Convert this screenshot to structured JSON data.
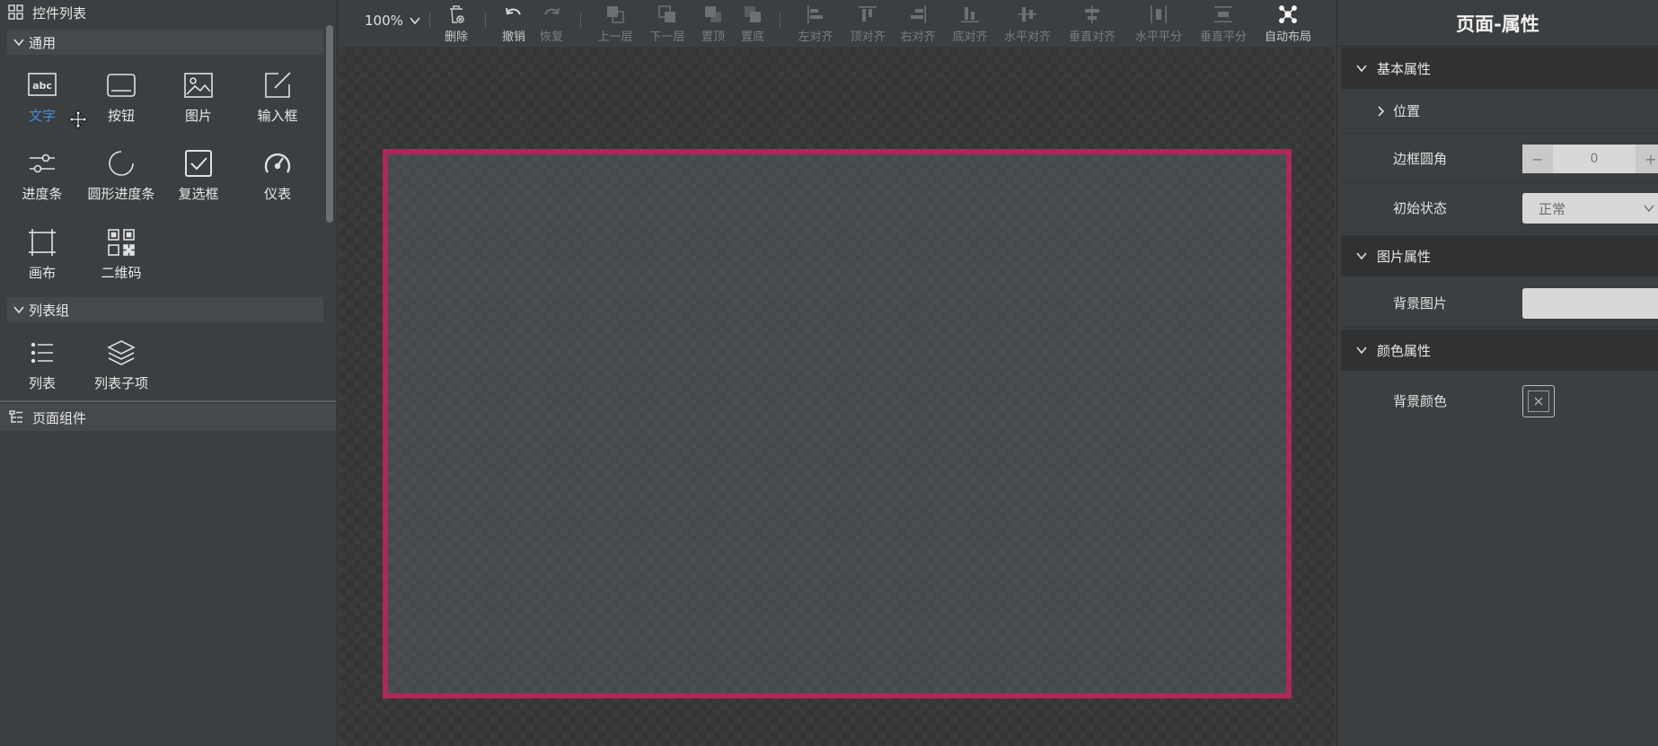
{
  "left_panel": {
    "title": "控件列表",
    "groups": [
      {
        "label": "通用",
        "items": [
          {
            "label": "文字",
            "icon": "text-icon"
          },
          {
            "label": "按钮",
            "icon": "button-icon"
          },
          {
            "label": "图片",
            "icon": "image-icon"
          },
          {
            "label": "输入框",
            "icon": "input-icon"
          },
          {
            "label": "进度条",
            "icon": "slider-icon"
          },
          {
            "label": "圆形进度条",
            "icon": "circle-progress-icon"
          },
          {
            "label": "复选框",
            "icon": "checkbox-icon"
          },
          {
            "label": "仪表",
            "icon": "gauge-icon"
          },
          {
            "label": "画布",
            "icon": "canvas-icon"
          },
          {
            "label": "二维码",
            "icon": "qrcode-icon"
          }
        ]
      },
      {
        "label": "列表组",
        "items": [
          {
            "label": "列表",
            "icon": "list-icon"
          },
          {
            "label": "列表子项",
            "icon": "layers-icon"
          }
        ]
      }
    ],
    "page_components_title": "页面组件",
    "active_color": "#3d8fe0"
  },
  "toolbar": {
    "zoom": "100%",
    "buttons": {
      "delete": "删除",
      "undo": "撤销",
      "redo": "恢复",
      "up_layer": "上一层",
      "down_layer": "下一层",
      "to_top": "置顶",
      "to_bottom": "置底",
      "align_left": "左对齐",
      "align_top": "顶对齐",
      "align_right": "右对齐",
      "align_bottom": "底对齐",
      "align_h_center": "水平对齐",
      "align_v_center": "垂直对齐",
      "distribute_h": "水平平分",
      "distribute_v": "垂直平分",
      "auto_layout": "自动布局"
    }
  },
  "canvas": {
    "frame_color": "#a8295a"
  },
  "right_panel": {
    "title": "页面-属性",
    "sections": {
      "basic": "基本属性",
      "position": "位置",
      "border_radius_label": "边框圆角",
      "border_radius_value": "0",
      "initial_state_label": "初始状态",
      "initial_state_value": "正常",
      "image": "图片属性",
      "bg_image_label": "背景图片",
      "color": "颜色属性",
      "bg_color_label": "背景颜色"
    }
  }
}
